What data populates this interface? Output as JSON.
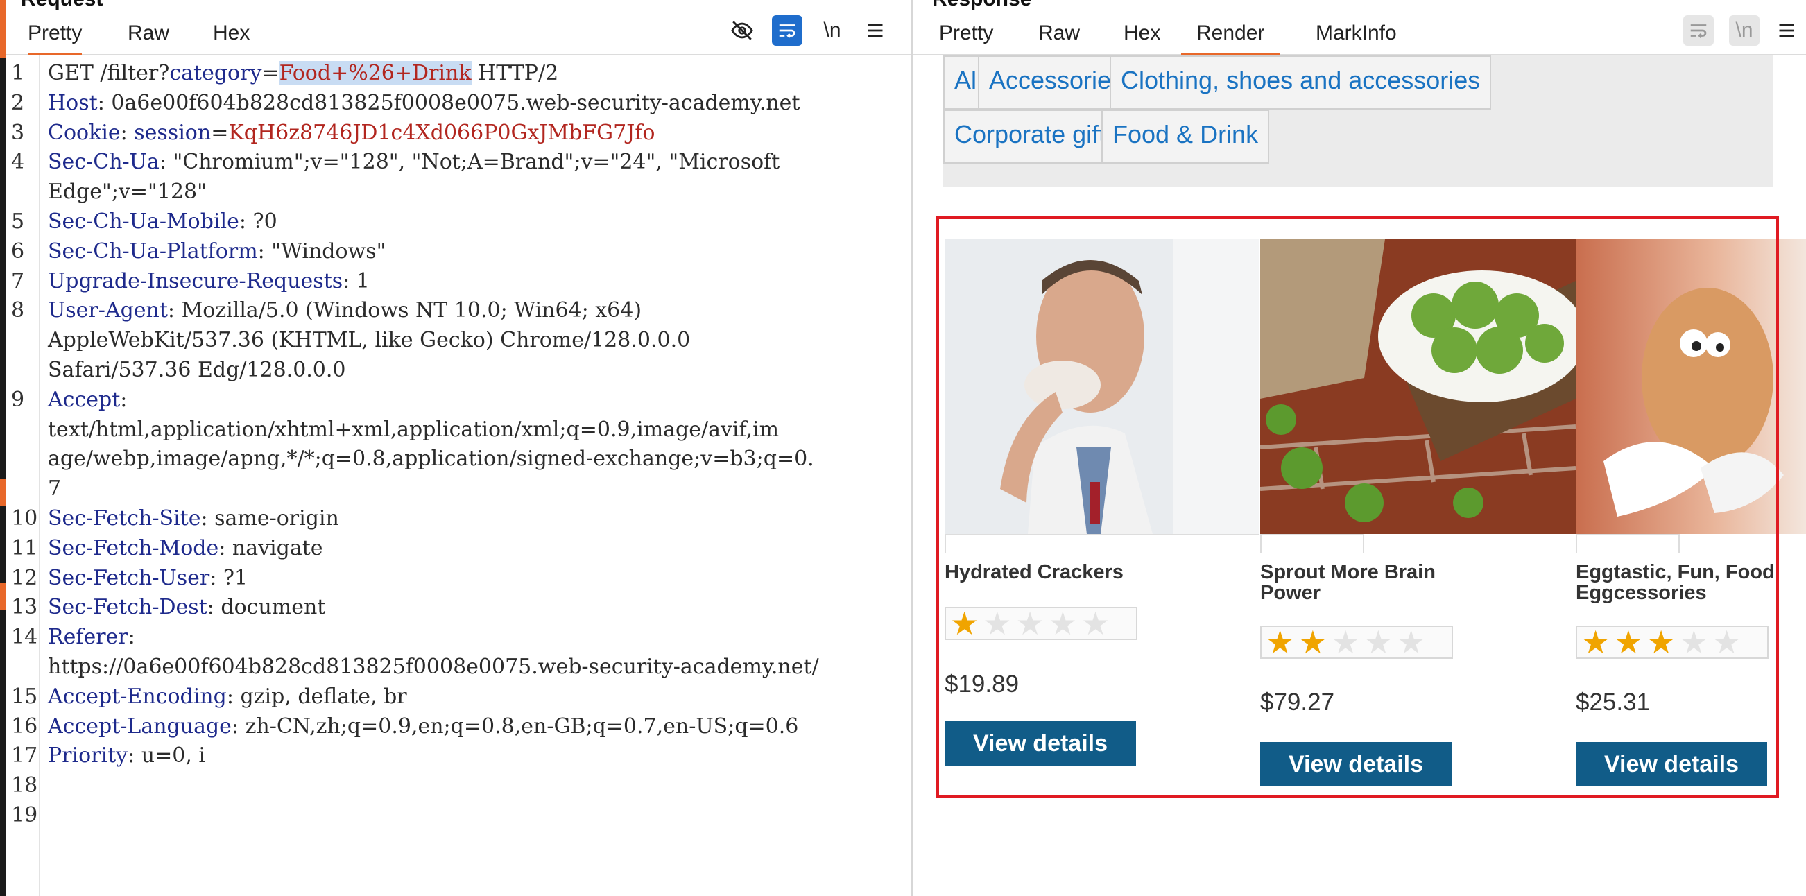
{
  "request": {
    "title": "Request",
    "tabs": [
      "Pretty",
      "Raw",
      "Hex"
    ],
    "active_tab": "Pretty",
    "toolbar": {
      "hide_icon": "eye-slash-icon",
      "wrap_icon": "wrap-lines-icon",
      "newline_label": "\\n",
      "menu_icon": "hamburger-menu-icon"
    },
    "line_numbers": [
      "1",
      "2",
      "3",
      "4",
      "5",
      "6",
      "7",
      "8",
      "9",
      "10",
      "11",
      "12",
      "13",
      "14",
      "15",
      "16",
      "17",
      "18",
      "19"
    ],
    "lines": [
      {
        "n": "1",
        "segments": [
          {
            "t": "GET /filter?",
            "c": "p"
          },
          {
            "t": "category",
            "c": "k"
          },
          {
            "t": "=",
            "c": "p"
          },
          {
            "t": "Food+%26+Drink",
            "c": "sel"
          },
          {
            "t": " HTTP/2",
            "c": "p"
          }
        ]
      },
      {
        "n": "2",
        "segments": [
          {
            "t": "Host",
            "c": "k"
          },
          {
            "t": ": 0a6e00f604b828cd813825f0008e0075.web-security-academy.net",
            "c": "p"
          }
        ]
      },
      {
        "n": "3",
        "segments": [
          {
            "t": "Cookie",
            "c": "k"
          },
          {
            "t": ": ",
            "c": "p"
          },
          {
            "t": "session",
            "c": "k"
          },
          {
            "t": "=",
            "c": "p"
          },
          {
            "t": "KqH6z8746JD1c4Xd066P0GxJMbFG7Jfo",
            "c": "v"
          }
        ]
      },
      {
        "n": "4",
        "segments": [
          {
            "t": "Sec-Ch-Ua",
            "c": "k"
          },
          {
            "t": ": \"Chromium\";v=\"128\", \"Not;A=Brand\";v=\"24\", \"Microsoft",
            "c": "p"
          }
        ]
      },
      {
        "n": "",
        "segments": [
          {
            "t": "Edge\";v=\"128\"",
            "c": "p"
          }
        ]
      },
      {
        "n": "5",
        "segments": [
          {
            "t": "Sec-Ch-Ua-Mobile",
            "c": "k"
          },
          {
            "t": ": ?0",
            "c": "p"
          }
        ]
      },
      {
        "n": "6",
        "segments": [
          {
            "t": "Sec-Ch-Ua-Platform",
            "c": "k"
          },
          {
            "t": ": \"Windows\"",
            "c": "p"
          }
        ]
      },
      {
        "n": "7",
        "segments": [
          {
            "t": "Upgrade-Insecure-Requests",
            "c": "k"
          },
          {
            "t": ": 1",
            "c": "p"
          }
        ]
      },
      {
        "n": "8",
        "segments": [
          {
            "t": "User-Agent",
            "c": "k"
          },
          {
            "t": ": Mozilla/5.0 (Windows NT 10.0; Win64; x64)",
            "c": "p"
          }
        ]
      },
      {
        "n": "",
        "segments": [
          {
            "t": "AppleWebKit/537.36 (KHTML, like Gecko) Chrome/128.0.0.0",
            "c": "p"
          }
        ]
      },
      {
        "n": "",
        "segments": [
          {
            "t": "Safari/537.36 Edg/128.0.0.0",
            "c": "p"
          }
        ]
      },
      {
        "n": "9",
        "segments": [
          {
            "t": "Accept",
            "c": "k"
          },
          {
            "t": ":",
            "c": "p"
          }
        ]
      },
      {
        "n": "",
        "segments": [
          {
            "t": "text/html,application/xhtml+xml,application/xml;q=0.9,image/avif,im",
            "c": "p"
          }
        ]
      },
      {
        "n": "",
        "segments": [
          {
            "t": "age/webp,image/apng,*/*;q=0.8,application/signed-exchange;v=b3;q=0.",
            "c": "p"
          }
        ]
      },
      {
        "n": "",
        "segments": [
          {
            "t": "7",
            "c": "p"
          }
        ]
      },
      {
        "n": "10",
        "segments": [
          {
            "t": "Sec-Fetch-Site",
            "c": "k"
          },
          {
            "t": ": same-origin",
            "c": "p"
          }
        ]
      },
      {
        "n": "11",
        "segments": [
          {
            "t": "Sec-Fetch-Mode",
            "c": "k"
          },
          {
            "t": ": navigate",
            "c": "p"
          }
        ]
      },
      {
        "n": "12",
        "segments": [
          {
            "t": "Sec-Fetch-User",
            "c": "k"
          },
          {
            "t": ": ?1",
            "c": "p"
          }
        ]
      },
      {
        "n": "13",
        "segments": [
          {
            "t": "Sec-Fetch-Dest",
            "c": "k"
          },
          {
            "t": ": document",
            "c": "p"
          }
        ]
      },
      {
        "n": "14",
        "segments": [
          {
            "t": "Referer",
            "c": "k"
          },
          {
            "t": ":",
            "c": "p"
          }
        ]
      },
      {
        "n": "",
        "segments": [
          {
            "t": "https://0a6e00f604b828cd813825f0008e0075.web-security-academy.net/",
            "c": "p"
          }
        ]
      },
      {
        "n": "15",
        "segments": [
          {
            "t": "Accept-Encoding",
            "c": "k"
          },
          {
            "t": ": gzip, deflate, br",
            "c": "p"
          }
        ]
      },
      {
        "n": "16",
        "segments": [
          {
            "t": "Accept-Language",
            "c": "k"
          },
          {
            "t": ": zh-CN,zh;q=0.9,en;q=0.8,en-GB;q=0.7,en-US;q=0.6",
            "c": "p"
          }
        ]
      },
      {
        "n": "17",
        "segments": [
          {
            "t": "Priority",
            "c": "k"
          },
          {
            "t": ": u=0, i",
            "c": "p"
          }
        ]
      },
      {
        "n": "18",
        "segments": []
      },
      {
        "n": "19",
        "segments": []
      }
    ]
  },
  "response": {
    "title": "Response",
    "tabs": [
      "Pretty",
      "Raw",
      "Hex",
      "Render",
      "MarkInfo"
    ],
    "active_tab": "Render",
    "toolbar": {
      "wrap_icon": "wrap-lines-icon",
      "newline_label": "\\n",
      "menu_icon": "hamburger-menu-icon"
    },
    "categories": [
      "All",
      "Accessories",
      "Clothing, shoes and accessories",
      "Corporate gifts",
      "Food & Drink"
    ],
    "products": [
      {
        "name": "Hydrated Crackers",
        "rating": 1,
        "price": "$19.89",
        "button": "View details",
        "image": "man-eating-cracker-photo"
      },
      {
        "name": "Sprout More Brain Power",
        "rating": 2,
        "price": "$79.27",
        "button": "View details",
        "image": "brussels-sprouts-bowl-photo"
      },
      {
        "name": "Eggtastic, Fun, Food Eggcessories",
        "rating": 3,
        "price": "$25.31",
        "button": "View details",
        "image": "cartoon-egg-photo"
      }
    ]
  },
  "colors": {
    "accent": "#e8682a",
    "toolbar_active": "#1f6dcc",
    "header_key": "#1e2a8c",
    "value_red": "#b2261f",
    "chip_link": "#1a73c2",
    "button": "#115c88",
    "star": "#f0a400",
    "highlight": "#e01a22"
  }
}
